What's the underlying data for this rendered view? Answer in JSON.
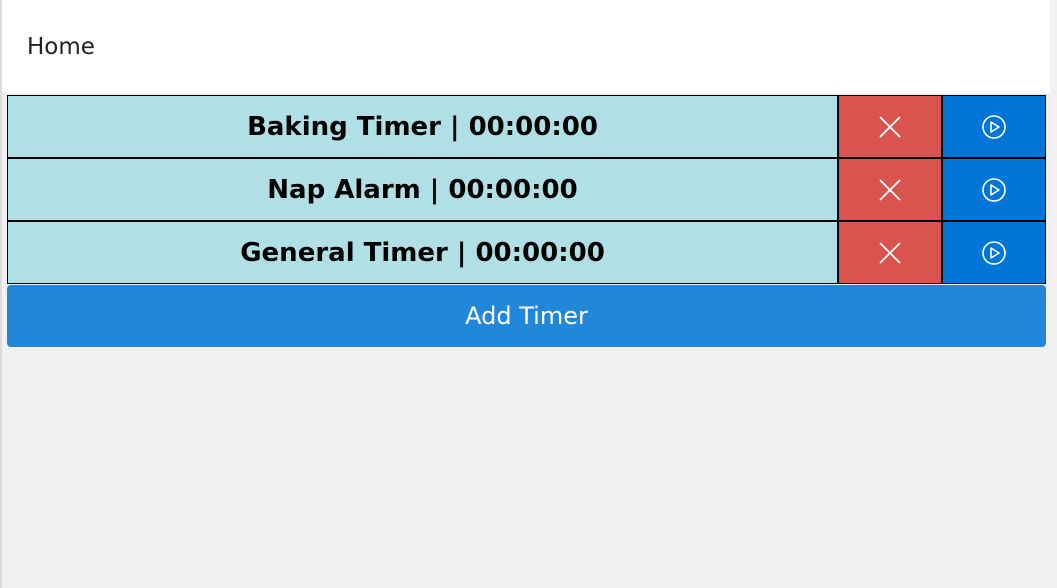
{
  "header": {
    "title": "Home"
  },
  "timers": [
    {
      "label": "Baking Timer | 00:00:00"
    },
    {
      "label": "Nap Alarm | 00:00:00"
    },
    {
      "label": "General Timer | 00:00:00"
    }
  ],
  "add_button": {
    "label": "Add Timer"
  },
  "icons": {
    "delete": "close-icon",
    "start": "play-circle-icon"
  },
  "colors": {
    "row": "#b0dfe5",
    "delete": "#d9534f",
    "play": "#0275d8",
    "add": "#2187db"
  }
}
